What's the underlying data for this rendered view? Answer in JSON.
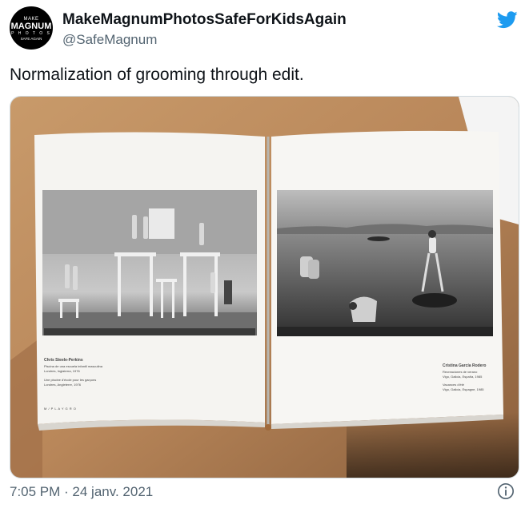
{
  "author": {
    "display_name": "MakeMagnumPhotosSafeForKidsAgain",
    "handle": "@SafeMagnum",
    "avatar_lines": [
      "MAKE",
      "MAGNUM",
      "P H O T O S",
      "SAFE AGAIN"
    ]
  },
  "tweet": {
    "text": "Normalization of grooming through edit."
  },
  "book": {
    "left_caption_name": "Chris Steele-Perkins",
    "left_caption_lines": [
      "Piscina de una escuela infantil masculina",
      "Londres, Inglaterra, 1976",
      "",
      "Une piscine d'école pour les garçons",
      "Londres, Angleterre, 1976"
    ],
    "left_footer": "M / P L A Y G R O",
    "right_caption_name": "Cristina García Rodero",
    "right_caption_lines": [
      "Recreaciones de verano",
      "Vigo, Galicia, España, 1985",
      "",
      "Vacances d'été",
      "Vigo, Galicia, Espagne, 1985"
    ]
  },
  "meta": {
    "timestamp": "7:05 PM · 24 janv. 2021"
  },
  "icons": {
    "bird": "twitter-bird-icon",
    "info": "info-icon"
  },
  "colors": {
    "twitter_blue": "#1d9bf0",
    "secondary_text": "#536471",
    "primary_text": "#0f1419"
  }
}
